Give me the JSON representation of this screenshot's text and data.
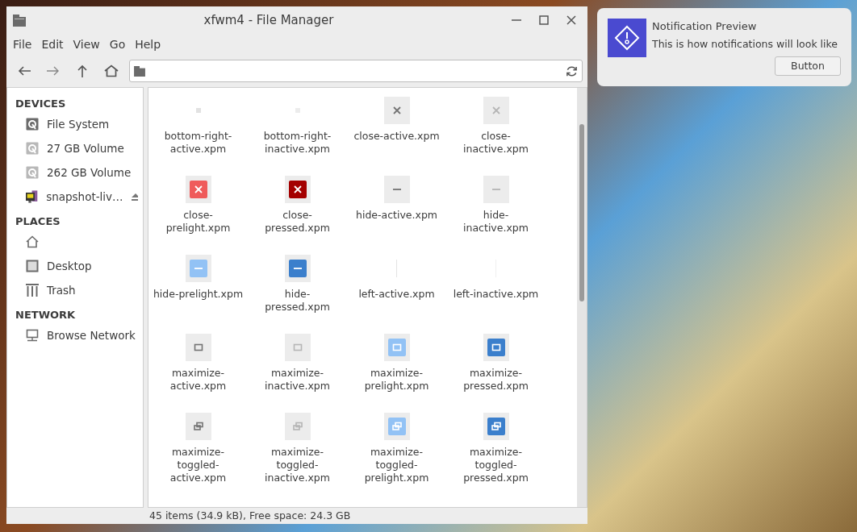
{
  "window": {
    "title": "xfwm4 - File Manager"
  },
  "menu": [
    "File",
    "Edit",
    "View",
    "Go",
    "Help"
  ],
  "sidebar": [
    {
      "heading": "DEVICES",
      "items": [
        {
          "kind": "drive",
          "label": "File System",
          "dim": false,
          "ejectable": false
        },
        {
          "kind": "drive",
          "label": "27 GB Volume",
          "dim": true,
          "ejectable": false
        },
        {
          "kind": "drive",
          "label": "262 GB Volume",
          "dim": true,
          "ejectable": false
        },
        {
          "kind": "media",
          "label": "snapshot-liv…",
          "dim": false,
          "ejectable": true
        }
      ]
    },
    {
      "heading": "PLACES",
      "items": [
        {
          "kind": "home",
          "dim": false,
          "ejectable": false
        },
        {
          "kind": "desktop",
          "label": "Desktop",
          "dim": false,
          "ejectable": false
        },
        {
          "kind": "trash",
          "label": "Trash",
          "dim": false,
          "ejectable": false
        }
      ]
    },
    {
      "heading": "NETWORK",
      "items": [
        {
          "kind": "network",
          "label": "Browse Network",
          "dim": false,
          "ejectable": false
        }
      ]
    }
  ],
  "files": [
    {
      "name": "bottom-right-active.xpm",
      "kind": "dot-active"
    },
    {
      "name": "bottom-right-inactive.xpm",
      "kind": "dot-inactive"
    },
    {
      "name": "close-active.xpm",
      "kind": "close-active"
    },
    {
      "name": "close-inactive.xpm",
      "kind": "close-inactive"
    },
    {
      "name": "close-prelight.xpm",
      "kind": "close-prelight"
    },
    {
      "name": "close-pressed.xpm",
      "kind": "close-pressed"
    },
    {
      "name": "hide-active.xpm",
      "kind": "hide-active"
    },
    {
      "name": "hide-inactive.xpm",
      "kind": "hide-inactive"
    },
    {
      "name": "hide-prelight.xpm",
      "kind": "hide-prelight"
    },
    {
      "name": "hide-pressed.xpm",
      "kind": "hide-pressed"
    },
    {
      "name": "left-active.xpm",
      "kind": "line-active"
    },
    {
      "name": "left-inactive.xpm",
      "kind": "line-inactive"
    },
    {
      "name": "maximize-active.xpm",
      "kind": "maximize-active"
    },
    {
      "name": "maximize-inactive.xpm",
      "kind": "maximize-inactive"
    },
    {
      "name": "maximize-prelight.xpm",
      "kind": "maximize-prelight"
    },
    {
      "name": "maximize-pressed.xpm",
      "kind": "maximize-pressed"
    },
    {
      "name": "maximize-toggled-active.xpm",
      "kind": "restore-active"
    },
    {
      "name": "maximize-toggled-inactive.xpm",
      "kind": "restore-inactive"
    },
    {
      "name": "maximize-toggled-prelight.xpm",
      "kind": "restore-prelight"
    },
    {
      "name": "maximize-toggled-pressed.xpm",
      "kind": "restore-pressed"
    }
  ],
  "status_bar": "45 items (34.9 kB), Free space: 24.3 GB",
  "notification": {
    "title": "Notification Preview",
    "body": "This is how notifications will look like",
    "button": "Button"
  }
}
